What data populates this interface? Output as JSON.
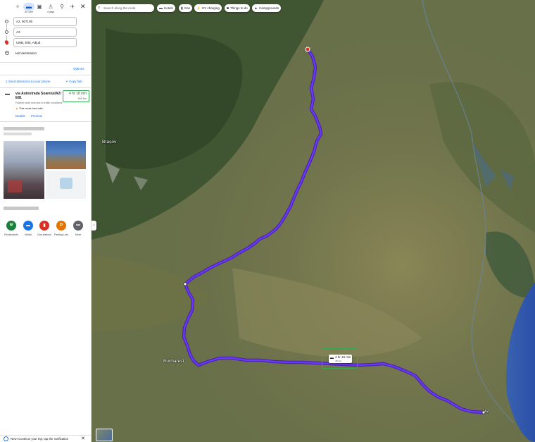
{
  "travel_modes": [
    {
      "label": "",
      "icon": "sparkle-icon"
    },
    {
      "label": "4h 18m",
      "icon": "car-icon"
    },
    {
      "label": "",
      "icon": "train-icon"
    },
    {
      "label": "4 days",
      "icon": "walk-icon"
    },
    {
      "label": "",
      "icon": "bike-icon"
    },
    {
      "label": "",
      "icon": "flight-icon"
    }
  ],
  "stops": [
    {
      "value": "A2, 907105"
    },
    {
      "value": "A3"
    },
    {
      "value": "UMB, E85, Adjud"
    }
  ],
  "add_destination": "Add destination",
  "options_label": "Options",
  "send_directions": "Send directions to your phone",
  "copy_link": "Copy link",
  "route": {
    "via": "via Autostrada Soarelui/A2/ E81",
    "time": "4 hr 18 min",
    "distance": "450 km",
    "note": "Fastest route now due to traffic conditions",
    "tolls": "This route has tolls.",
    "details": "Details",
    "preview": "Preview"
  },
  "categories": [
    {
      "label": "Restaurants",
      "icon": "fork-knife-icon",
      "color": "#188038"
    },
    {
      "label": "Hotels",
      "icon": "bed-icon",
      "color": "#1a73e8"
    },
    {
      "label": "Gas stations",
      "icon": "gas-icon",
      "color": "#d93025"
    },
    {
      "label": "Parking Lots",
      "icon": "parking-icon",
      "color": "#e37400"
    },
    {
      "label": "More",
      "icon": "more-icon",
      "color": "#5f6368"
    }
  ],
  "notification": "New! Continue your trip, tap the notification",
  "map": {
    "search_placeholder": "Search along the route",
    "chips": [
      {
        "label": "Hotels",
        "icon": "bed-icon"
      },
      {
        "label": "Gas",
        "icon": "gas-icon"
      },
      {
        "label": "EV charging",
        "icon": "ev-icon"
      },
      {
        "label": "Things to do",
        "icon": "camera-icon"
      },
      {
        "label": "Campgrounds",
        "icon": "tent-icon"
      }
    ],
    "labels": {
      "brasov": "Brașov",
      "bucharest": "Bucharest",
      "a2": "A2"
    },
    "route_bubble": {
      "time": "4 hr 18 min",
      "distance": "450 km"
    }
  },
  "colors": {
    "route": "#5b2ed6",
    "highlight": "#34a853",
    "link": "#1a73e8"
  }
}
